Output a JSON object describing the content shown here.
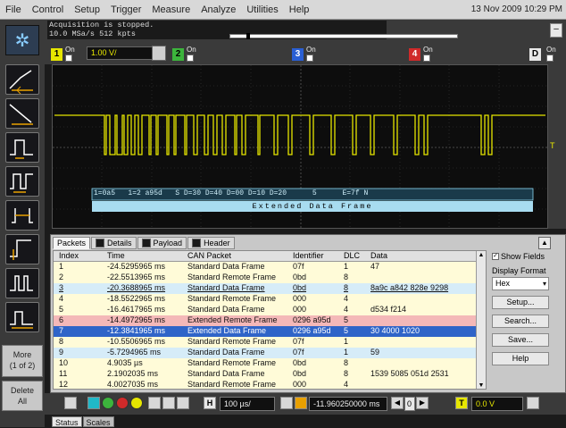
{
  "menu": {
    "items": [
      "File",
      "Control",
      "Setup",
      "Trigger",
      "Measure",
      "Analyze",
      "Utilities",
      "Help"
    ],
    "datetime": "13 Nov 2009 10:29 PM"
  },
  "status": {
    "line1": "Acquisition is stopped.",
    "line2": "10.0 MSa/s   512 kpts"
  },
  "channels": {
    "ch1": {
      "num": "1",
      "on": "On",
      "scale": "1.00 V/",
      "color": "#e6e600"
    },
    "ch2": {
      "num": "2",
      "on": "On",
      "color": "#3cb43c"
    },
    "ch3": {
      "num": "3",
      "on": "On",
      "color": "#2a5fd4"
    },
    "ch4": {
      "num": "4",
      "on": "On",
      "color": "#d02a2a"
    },
    "digital": {
      "num": "D",
      "on": "On"
    }
  },
  "decode": {
    "bus_text": "1=0a5   1=2 a95d   S D=30 D=40 D=00 D=10 D=20      5      E=7f N",
    "frame_label": "Extended Data Frame"
  },
  "left_toolbar": {
    "more_line1": "More",
    "more_line2": "(1 of 2)",
    "delete_line1": "Delete",
    "delete_line2": "All"
  },
  "tabs": [
    "Packets",
    "Details",
    "Payload",
    "Header"
  ],
  "table": {
    "headers": [
      "Index",
      "Time",
      "CAN Packet",
      "Identifier",
      "DLC",
      "Data"
    ],
    "rows": [
      {
        "index": "1",
        "time": "-24.5295965 ms",
        "packet": "Standard Data Frame",
        "id": "07f",
        "dlc": "1",
        "data": "47",
        "bg": "#fffbd8"
      },
      {
        "index": "2",
        "time": "-22.5513965 ms",
        "packet": "Standard Remote Frame",
        "id": "0bd",
        "dlc": "8",
        "data": "",
        "bg": "#fffbd8"
      },
      {
        "index": "3",
        "time": "-20.3688965 ms",
        "packet": "Standard Data Frame",
        "id": "0bd",
        "dlc": "8",
        "data": "8a9c a842 828e 9298",
        "bg": "#d6ecf8"
      },
      {
        "index": "4",
        "time": "-18.5522965 ms",
        "packet": "Standard Remote Frame",
        "id": "000",
        "dlc": "4",
        "data": "",
        "bg": "#fffbd8"
      },
      {
        "index": "5",
        "time": "-16.4617965 ms",
        "packet": "Standard Data Frame",
        "id": "000",
        "dlc": "4",
        "data": "d534 f214",
        "bg": "#fffbd8"
      },
      {
        "index": "6",
        "time": "-14.4972965 ms",
        "packet": "Extended Remote Frame",
        "id": "0296 a95d",
        "dlc": "5",
        "data": "",
        "bg": "#f4b8b8"
      },
      {
        "index": "7",
        "time": "-12.3841965 ms",
        "packet": "Extended Data Frame",
        "id": "0296 a95d",
        "dlc": "5",
        "data": "30 4000 1020",
        "bg": "#2f64c8"
      },
      {
        "index": "8",
        "time": "-10.5506965 ms",
        "packet": "Standard Remote Frame",
        "id": "07f",
        "dlc": "1",
        "data": "",
        "bg": "#fffbd8"
      },
      {
        "index": "9",
        "time": "-5.7294965 ms",
        "packet": "Standard Data Frame",
        "id": "07f",
        "dlc": "1",
        "data": "59",
        "bg": "#d6ecf8"
      },
      {
        "index": "10",
        "time": "4.9035 µs",
        "packet": "Standard Remote Frame",
        "id": "0bd",
        "dlc": "8",
        "data": "",
        "bg": "#fffbd8"
      },
      {
        "index": "11",
        "time": "2.1902035 ms",
        "packet": "Standard Data Frame",
        "id": "0bd",
        "dlc": "8",
        "data": "1539 5085 051d 2531",
        "bg": "#fffbd8"
      },
      {
        "index": "12",
        "time": "4.0027035 ms",
        "packet": "Standard Remote Frame",
        "id": "000",
        "dlc": "4",
        "data": "",
        "bg": "#fffbd8"
      }
    ]
  },
  "side_panel": {
    "show_fields": "Show Fields",
    "display_format_label": "Display Format",
    "format_value": "Hex",
    "setup": "Setup...",
    "search": "Search...",
    "save": "Save...",
    "help": "Help"
  },
  "bottom_toolbar": {
    "timebase": "100 µs/",
    "delay": "-11.960250000 ms",
    "nav_value": "0",
    "trigger_level": "0.0 V",
    "trigger_src": "T",
    "h_label": "H"
  },
  "bottom_tabs": [
    "Status",
    "Scales"
  ]
}
